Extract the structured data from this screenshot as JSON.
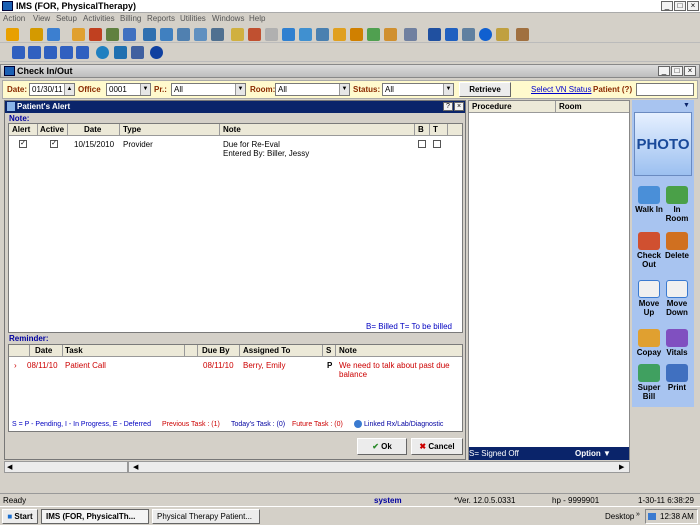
{
  "app": {
    "title": "IMS (FOR, PhysicalTherapy)"
  },
  "menu": [
    "Action",
    "View",
    "Setup",
    "Activities",
    "Billing",
    "Reports",
    "Utilities",
    "Windows",
    "Help"
  ],
  "window": {
    "title": "Check In/Out"
  },
  "filters": {
    "date_label": "Date:",
    "date": "01/30/11",
    "office_label": "Office",
    "office": "0001",
    "pr_label": "Pr.:",
    "pr": "All",
    "room_label": "Room:",
    "room": "All",
    "status_label": "Status:",
    "status": "All",
    "retrieve": "Retrieve",
    "select_vn": "Select VN Status",
    "patient_label": "Patient (?)"
  },
  "alert": {
    "title": "Patient's Alert",
    "note_section": "Note:",
    "columns": [
      "Alert",
      "Active",
      "Date",
      "Type",
      "Note",
      "B",
      "T"
    ],
    "rows": [
      {
        "alert": "✓",
        "active": "✓",
        "date": "10/15/2010",
        "type": "Provider",
        "note1": "Due for Re-Eval",
        "note2": "Entered By: Biller, Jessy"
      }
    ],
    "legend": "B= Billed  T= To be billed"
  },
  "reminder": {
    "section": "Reminder:",
    "columns": [
      "Date",
      "Task",
      "Due By",
      "Assigned To",
      "S",
      "Note"
    ],
    "rows": [
      {
        "date": "08/11/10",
        "task": "Patient Call",
        "due": "08/11/10",
        "assigned": "Berry, Emily",
        "s": "P",
        "note1": "We need to talk about past due",
        "note2": "balance"
      }
    ],
    "legend": "S = P - Pending, I - In Progress, E - Deferred",
    "previous": "Previous Task : (1)",
    "today": "Today's Task : (0)",
    "future": "Future Task : (0)",
    "linked": "Linked Rx/Lab/Diagnostic"
  },
  "buttons": {
    "ok": "Ok",
    "cancel": "Cancel"
  },
  "right": {
    "col_procedure": "Procedure",
    "col_room": "Room",
    "signed_off": "S= Signed Off",
    "option": "Option"
  },
  "side": {
    "photo": "PHOTO",
    "walk_in": "Walk In",
    "in_room": "In Room",
    "check_out": "Check Out",
    "delete": "Delete",
    "move_up": "Move Up",
    "move_down": "Move Down",
    "copay": "Copay",
    "vitals": "Vitals",
    "super_bill": "Super Bill",
    "print": "Print"
  },
  "statusbar": {
    "ready": "Ready",
    "system": "system",
    "ver": "*Ver. 12.0.5.0331",
    "hp": "hp - 9999901",
    "datetime": "1-30-11  6:38:29"
  },
  "taskbar": {
    "start": "Start",
    "task1": "IMS (FOR, PhysicalTh...",
    "task2": "Physical Therapy Patient...",
    "desktop": "Desktop",
    "clock": "12:38 AM"
  },
  "colors": {
    "alert_red": "#cc0000",
    "nav_blue": "#0000a0",
    "side_blue": "#a8c4f0",
    "photo_text": "#1a4a9a"
  }
}
